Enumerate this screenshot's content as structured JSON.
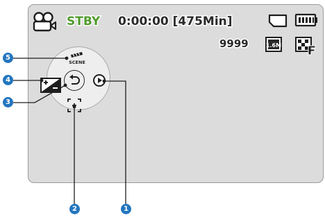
{
  "status_bar": {
    "mode": "STBY",
    "timecode": "0:00:00 [475Min]"
  },
  "info_bar": {
    "photo_count": "9999",
    "resolution": "1.6M"
  },
  "menu_dial": {
    "scene_label": "SCENE"
  },
  "callouts": [
    "1",
    "2",
    "3",
    "4",
    "5"
  ],
  "icons": {
    "camcorder": "camcorder-icon",
    "storage": "memory-card-icon",
    "battery": "battery-icon",
    "resolution": "photo-resolution-icon",
    "quality": "image-quality-icon",
    "scene": "scene-mode-icon",
    "exposure": "exposure-icon",
    "return": "return-icon",
    "play": "play-icon",
    "focus": "focus-icon"
  },
  "colors": {
    "status_green": "#4f9a2c",
    "callout_blue": "#2376bf",
    "screen_gray": "#dcdcdc"
  }
}
